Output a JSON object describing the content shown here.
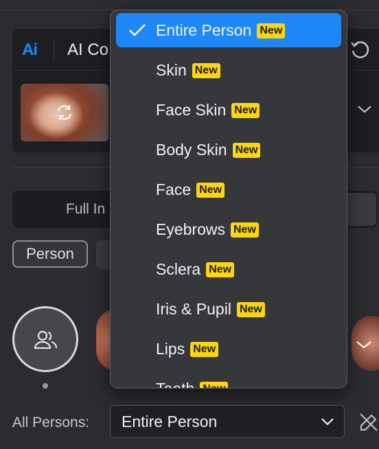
{
  "header": {
    "logo": "Ai",
    "title": "AI Co"
  },
  "mode_tabs": {
    "left": "Full In"
  },
  "chips": {
    "person": "Person"
  },
  "dropdown": {
    "items": [
      {
        "label": "Entire Person",
        "badge": "New",
        "selected": true
      },
      {
        "label": "Skin",
        "badge": "New"
      },
      {
        "label": "Face Skin",
        "badge": "New"
      },
      {
        "label": "Body Skin",
        "badge": "New"
      },
      {
        "label": "Face",
        "badge": "New"
      },
      {
        "label": "Eyebrows",
        "badge": "New"
      },
      {
        "label": "Sclera",
        "badge": "New"
      },
      {
        "label": "Iris & Pupil",
        "badge": "New"
      },
      {
        "label": "Lips",
        "badge": "New"
      },
      {
        "label": "Teeth",
        "badge": "New"
      }
    ]
  },
  "footer": {
    "label": "All Persons:",
    "select_value": "Entire Person"
  },
  "colors": {
    "accent": "#1f88f8",
    "badge": "#ffd60a",
    "background": "#2b2c30"
  },
  "icons": [
    "checkmark-icon",
    "refresh-icon",
    "chevron-down-icon",
    "persons-icon",
    "rotate-icon",
    "edit-icon"
  ]
}
